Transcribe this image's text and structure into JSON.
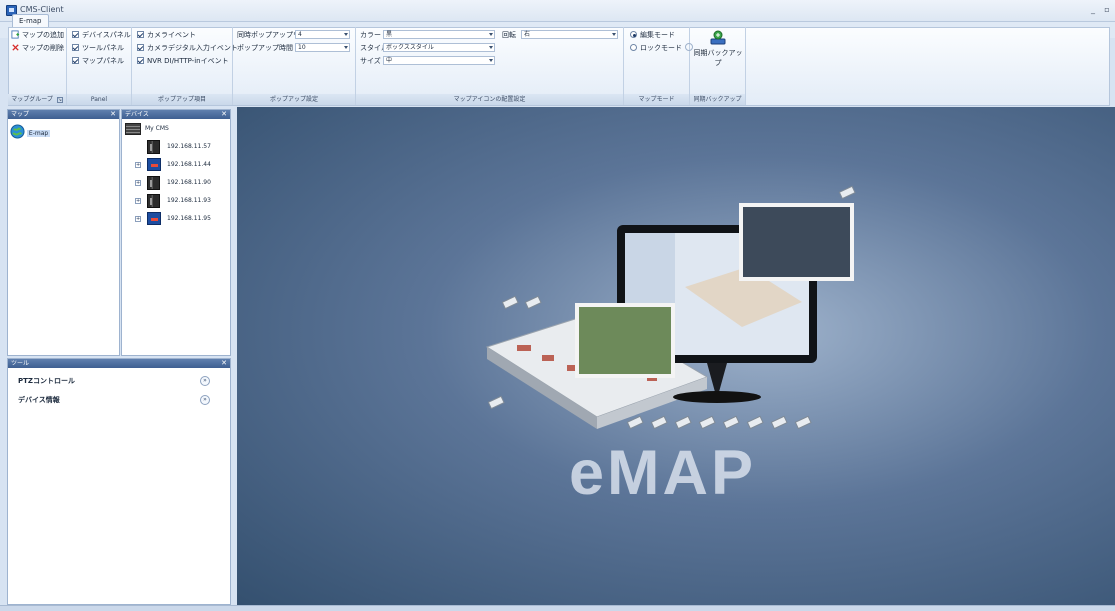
{
  "window": {
    "title": "CMS-Client"
  },
  "tabs": [
    {
      "label": "E-map"
    }
  ],
  "ribbon": {
    "map_group": {
      "add_label": "マップの追加",
      "delete_label": "マップの削除",
      "caption": "マップグループ"
    },
    "panel_group": {
      "device_panel": "デバイスパネル",
      "tool_panel": "ツールパネル",
      "map_panel": "マップパネル",
      "caption": "Panel"
    },
    "popup_items": {
      "camera_event": "カメライベント",
      "digital_input_event": "カメラデジタル入力イベント",
      "nvr_event": "NVR DI/HTTP-inイベント",
      "caption": "ポップアップ項目"
    },
    "popup_settings": {
      "simultaneous_label": "同時ポップアップウィンドウ数",
      "simultaneous_value": "4",
      "time_label": "ポップアップ時間",
      "time_value": "10",
      "caption": "ポップアップ設定"
    },
    "icon_settings": {
      "color_label": "カラー",
      "color_value": "黒",
      "rotation_label": "回転",
      "rotation_value": "右",
      "style_label": "スタイル",
      "style_value": "ボックススタイル",
      "size_label": "サイズ",
      "size_value": "中",
      "caption": "マップアイコンの配置設定"
    },
    "map_mode": {
      "edit_mode": "編集モード",
      "lock_mode": "ロックモード",
      "caption": "マップモード"
    },
    "backup": {
      "button_label": "同期バックアップ",
      "caption": "同期バックアップ"
    }
  },
  "map_panel": {
    "title": "マップ",
    "items": [
      {
        "label": "E-map"
      }
    ]
  },
  "device_panel": {
    "title": "デバイス",
    "root": "My CMS",
    "devices": [
      {
        "ip": "192.168.11.57",
        "kind": "nvr"
      },
      {
        "ip": "192.168.11.44",
        "kind": "camera"
      },
      {
        "ip": "192.168.11.90",
        "kind": "nvr"
      },
      {
        "ip": "192.168.11.93",
        "kind": "nvr"
      },
      {
        "ip": "192.168.11.95",
        "kind": "camera"
      }
    ]
  },
  "tool_panel": {
    "title": "ツール",
    "items": [
      {
        "label": "PTZコントロール"
      },
      {
        "label": "デバイス情報"
      }
    ]
  },
  "emap": {
    "logo_text": "eMAP"
  },
  "colors": {
    "ribbon_accent": "#3e5f91",
    "emap_background": "#5c7598"
  }
}
